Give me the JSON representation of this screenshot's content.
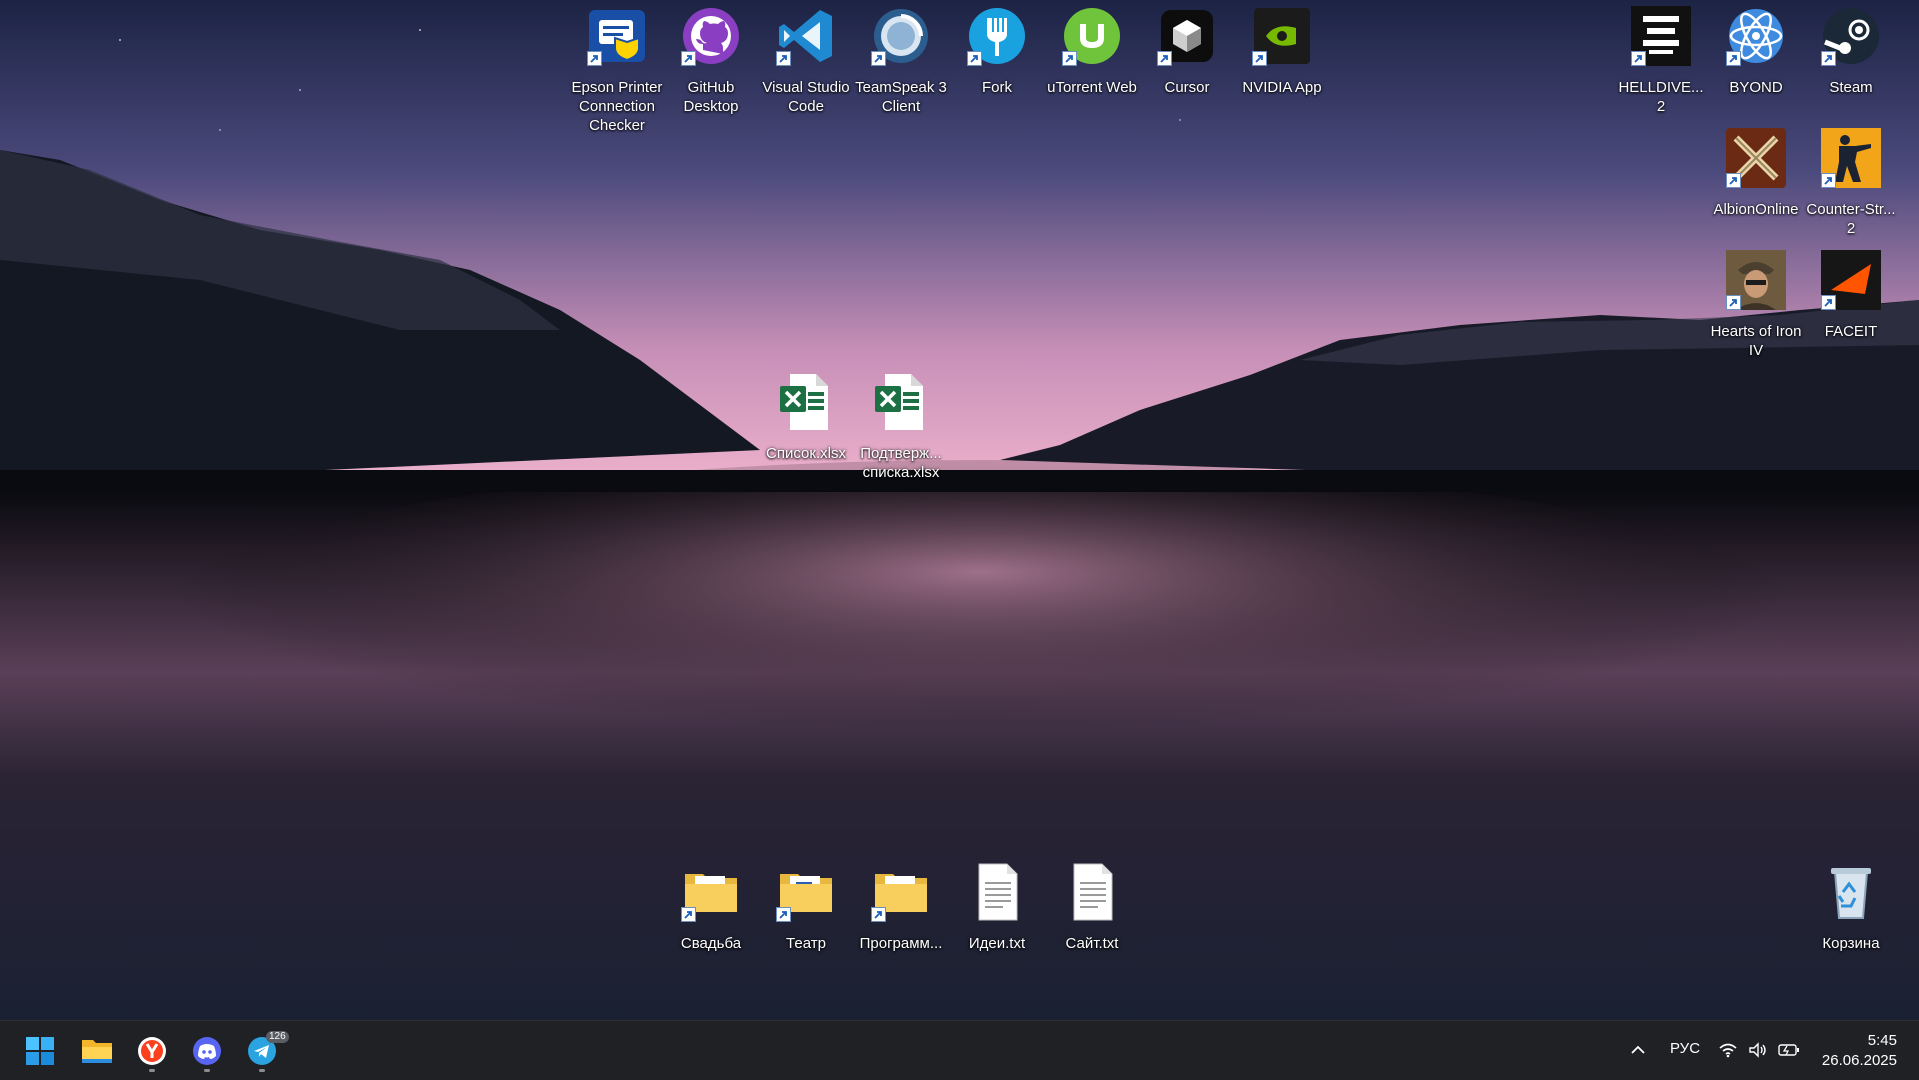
{
  "desktop": {
    "top_icons": [
      {
        "label": "Epson Printer\nConnection\nChecker",
        "icon": "epson-printer-icon"
      },
      {
        "label": "GitHub\nDesktop",
        "icon": "github-icon"
      },
      {
        "label": "Visual Studio\nCode",
        "icon": "vscode-icon"
      },
      {
        "label": "TeamSpeak 3\nClient",
        "icon": "teamspeak-icon"
      },
      {
        "label": "Fork",
        "icon": "fork-icon"
      },
      {
        "label": "uTorrent Web",
        "icon": "utorrent-icon"
      },
      {
        "label": "Cursor",
        "icon": "cursor-icon"
      },
      {
        "label": "NVIDIA App",
        "icon": "nvidia-icon"
      }
    ],
    "right_icons": [
      {
        "label": "HELLDIVE...\n2",
        "icon": "helldivers-icon"
      },
      {
        "label": "BYOND",
        "icon": "byond-icon"
      },
      {
        "label": "Steam",
        "icon": "steam-icon"
      },
      {
        "label": "AlbionOnline",
        "icon": "albion-icon"
      },
      {
        "label": "Counter-Str...\n2",
        "icon": "counter-strike-icon"
      },
      {
        "label": "Hearts of Iron\nIV",
        "icon": "hearts-of-iron-icon"
      },
      {
        "label": "FACEIT",
        "icon": "faceit-icon"
      }
    ],
    "files": [
      {
        "label": "Список.xlsx",
        "icon": "excel-file-icon"
      },
      {
        "label": "Подтверж...\nсписка.xlsx",
        "icon": "excel-file-icon"
      }
    ],
    "bottom_icons": [
      {
        "label": "Свадьба",
        "icon": "folder-icon"
      },
      {
        "label": "Театр",
        "icon": "folder-icon"
      },
      {
        "label": "Программ...",
        "icon": "folder-icon"
      },
      {
        "label": "Идеи.txt",
        "icon": "text-file-icon"
      },
      {
        "label": "Сайт.txt",
        "icon": "text-file-icon"
      }
    ],
    "recycle_bin": {
      "label": "Корзина",
      "icon": "recycle-bin-icon"
    }
  },
  "taskbar": {
    "apps": [
      {
        "name": "start",
        "icon": "windows-start-icon"
      },
      {
        "name": "explorer",
        "icon": "file-explorer-icon"
      },
      {
        "name": "yandex",
        "icon": "yandex-browser-icon"
      },
      {
        "name": "discord",
        "icon": "discord-icon"
      },
      {
        "name": "telegram",
        "icon": "telegram-icon",
        "badge": "126"
      }
    ],
    "language": "РУС",
    "time": "5:45",
    "date": "26.06.2025"
  },
  "colors": {
    "sky_top": "#1b2140",
    "sky_horizon": "#e8a9c6",
    "water": "#0a0c14",
    "taskbar": "#1f2124"
  }
}
